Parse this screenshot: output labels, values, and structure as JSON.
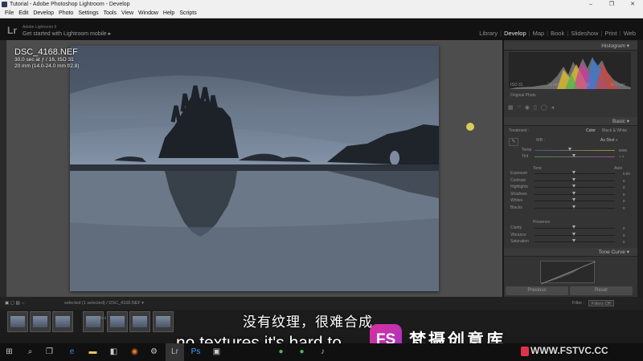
{
  "window": {
    "title": "Tutorial - Adobe Photoshop Lightroom - Develop",
    "controls": [
      "–",
      "❐",
      "✕"
    ]
  },
  "menu": [
    "File",
    "Edit",
    "Develop",
    "Photo",
    "Settings",
    "Tools",
    "View",
    "Window",
    "Help",
    "Scripts"
  ],
  "identity": {
    "logo": "Lr",
    "small": "Adobe Lightroom 6",
    "main": "Get started with Lightroom mobile ▸"
  },
  "modules": [
    "Library",
    "Develop",
    "Map",
    "Book",
    "Slideshow",
    "Print",
    "Web"
  ],
  "photo": {
    "filename": "DSC_4168.NEF",
    "exposure": "30.0 sec at ƒ / 16, ISO 31",
    "lens": "20 mm (14.0-24.0 mm f/2.8)"
  },
  "histogram": {
    "title": "Histogram",
    "iso": "ISO 31",
    "focal": "20 mm",
    "aperture": "ƒ / 16",
    "shutter": "30.0 sec",
    "original": "Original Photo"
  },
  "basic": {
    "title": "Basic",
    "treatment_label": "Treatment :",
    "treatment_color": "Color",
    "treatment_bw": "Black & White",
    "wb_label": "WB :",
    "wb_value": "As Shot ÷",
    "temp_label": "Temp",
    "temp_value": "5000",
    "tint_label": "Tint",
    "tint_value": "+ 7",
    "tone_label": "Tone",
    "auto": "Auto",
    "sliders": [
      {
        "label": "Exposure",
        "value": "0.00"
      },
      {
        "label": "Contrast",
        "value": "0"
      },
      {
        "label": "Highlights",
        "value": "0"
      },
      {
        "label": "Shadows",
        "value": "0"
      },
      {
        "label": "Whites",
        "value": "0"
      },
      {
        "label": "Blacks",
        "value": "0"
      }
    ],
    "presence_label": "Presence",
    "presence": [
      {
        "label": "Clarity",
        "value": "0"
      },
      {
        "label": "Vibrance",
        "value": "0"
      },
      {
        "label": "Saturation",
        "value": "0"
      }
    ]
  },
  "tonecurve": {
    "title": "Tone Curve"
  },
  "buttons": {
    "previous": "Previous",
    "reset": "Reset"
  },
  "filmstrip": {
    "path": "selected  (1 selected)  / DSC_4168.NEF ▾",
    "path2": "ected",
    "filter_label": "Filter :",
    "filter_value": "Filters Off"
  },
  "subtitles": {
    "cn": "没有纹理，很难合成",
    "en": "no textures it's hard to"
  },
  "branding": {
    "logo": "FS",
    "name": "梵摄创意库",
    "url": "WWW.FSTVC.CC"
  }
}
